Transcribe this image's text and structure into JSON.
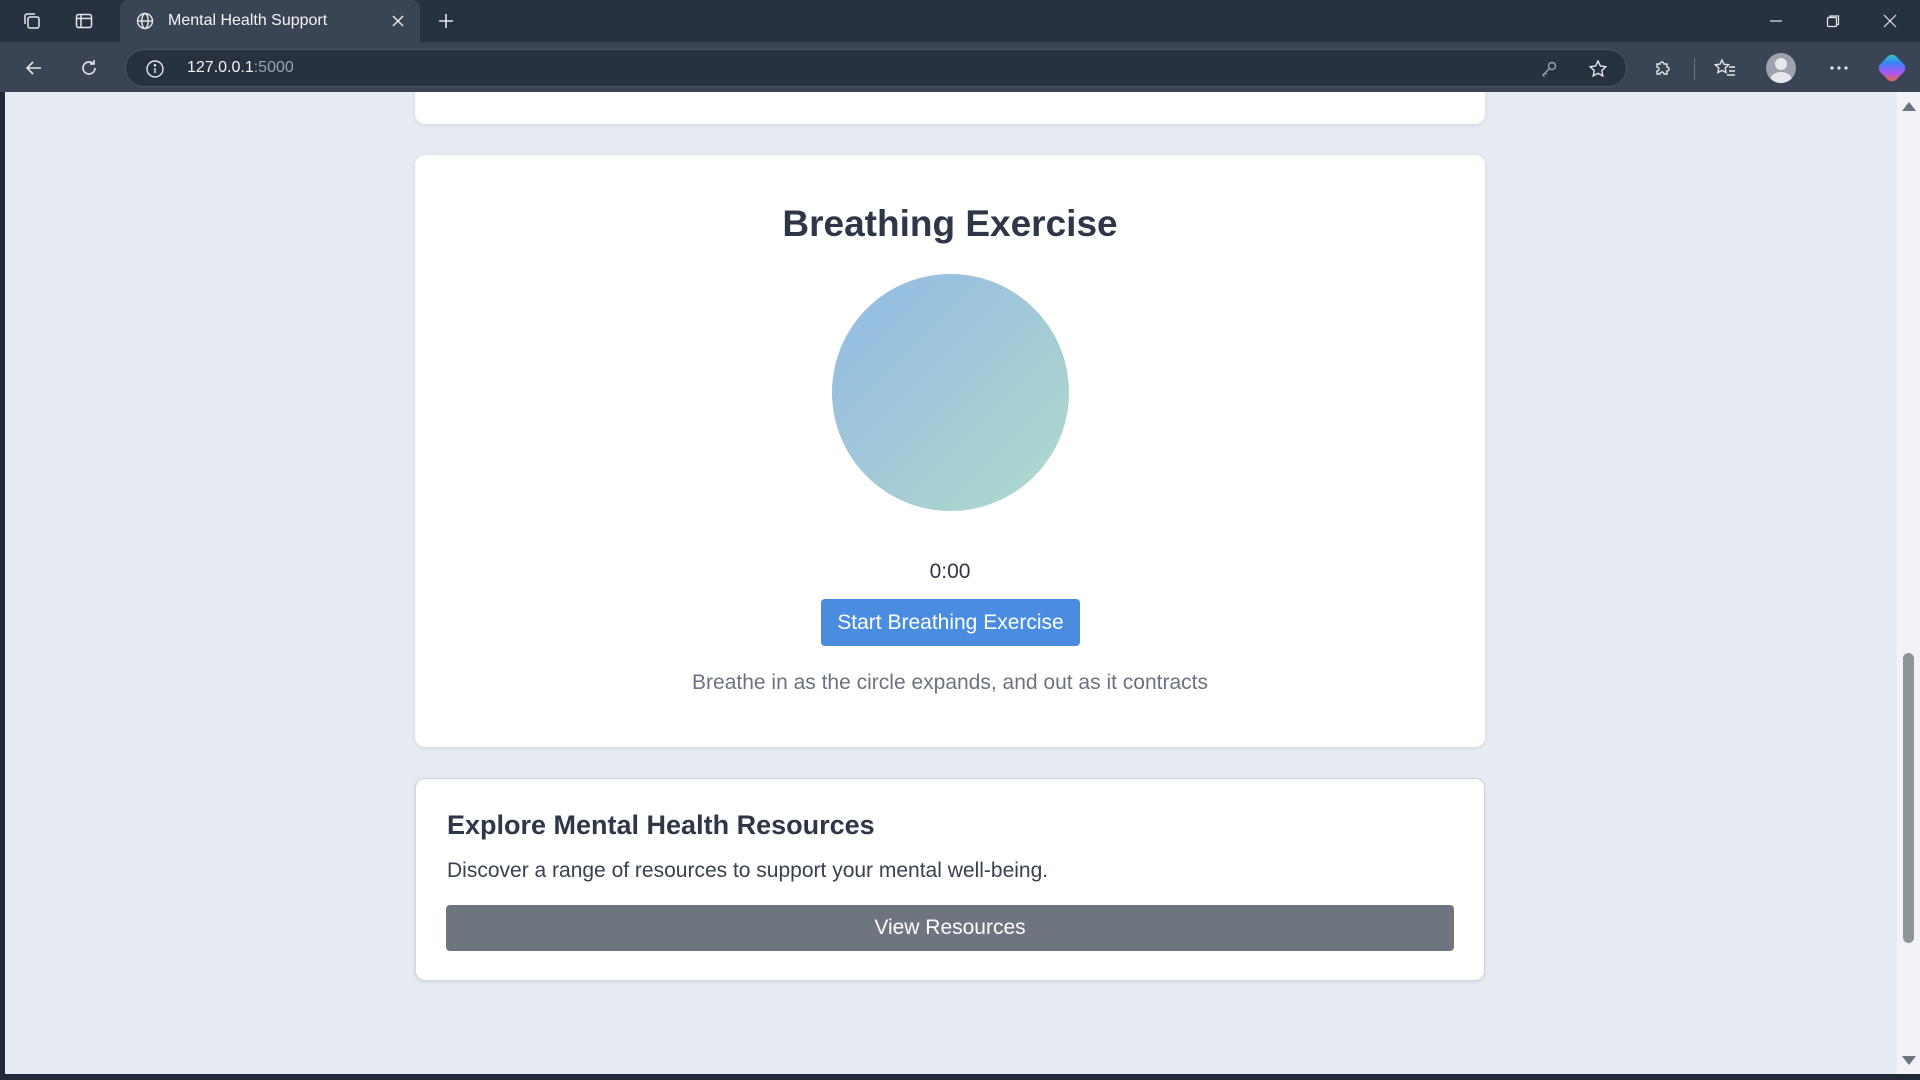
{
  "browser": {
    "tab_title": "Mental Health Support",
    "url_host": "127.0.0.1",
    "url_port": ":5000"
  },
  "breathing": {
    "title": "Breathing Exercise",
    "timer": "0:00",
    "start_label": "Start Breathing Exercise",
    "instruction": "Breathe in as the circle expands, and out as it contracts",
    "circle_gradient": [
      "#90bbe6",
      "#b0dccb"
    ]
  },
  "resources": {
    "title": "Explore Mental Health Resources",
    "description": "Discover a range of resources to support your mental well-being.",
    "button_label": "View Resources"
  },
  "colors": {
    "primary": "#4a8de0",
    "secondary": "#6e7580",
    "page_bg": "#e7ebf2",
    "heading": "#2d3748"
  },
  "icons": {
    "tab_actions": "tab-actions-icon",
    "vertical_tabs": "vertical-tabs-icon",
    "tab_site": "globe-icon",
    "tab_close": "close-icon",
    "new_tab": "plus-icon",
    "back": "back-arrow-icon",
    "reload": "reload-icon",
    "site_info": "info-icon",
    "password": "key-icon",
    "favorite": "star-icon",
    "extensions": "puzzle-icon",
    "favorites": "favorites-icon",
    "profile": "avatar",
    "more": "more-icon",
    "copilot": "copilot-icon"
  }
}
